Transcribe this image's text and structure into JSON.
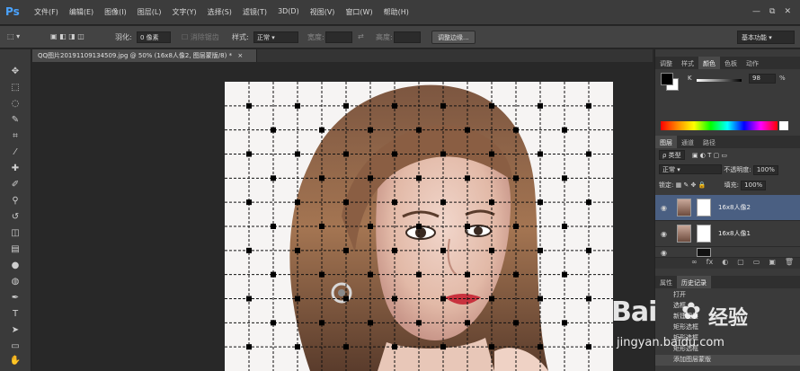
{
  "app": {
    "logo": "Ps"
  },
  "menu": [
    "文件(F)",
    "编辑(E)",
    "图像(I)",
    "图层(L)",
    "文字(Y)",
    "选择(S)",
    "滤镜(T)",
    "3D(D)",
    "视图(V)",
    "窗口(W)",
    "帮助(H)"
  ],
  "window_controls": [
    "—",
    "⧉",
    "✕"
  ],
  "options_bar": {
    "feather_label": "羽化:",
    "feather_value": "0 像素",
    "antialias_label": "消除锯齿",
    "style_label": "样式:",
    "style_value": "正常",
    "width_label": "宽度:",
    "height_label": "高度:",
    "refine_button": "调整边缘...",
    "workspace": "基本功能"
  },
  "document": {
    "tab_title": "QQ图片20191109134509.jpg @ 50% (16x8人像2, 图层蒙版/8) *",
    "close": "×"
  },
  "color_panel": {
    "tabs": [
      "调整",
      "样式",
      "颜色",
      "色板",
      "动作"
    ],
    "active_tab": 2,
    "channel": "K",
    "value": "98",
    "unit": "%"
  },
  "layers_panel": {
    "tabs": [
      "图层",
      "通道",
      "路径"
    ],
    "active_tab": 0,
    "kind_label": "ρ 类型",
    "blend_mode": "正常",
    "opacity_label": "不透明度:",
    "opacity_value": "100%",
    "lock_label": "锁定:",
    "fill_label": "填充:",
    "fill_value": "100%",
    "layers": [
      {
        "name": "16x8人像2",
        "selected": true,
        "mask": "white"
      },
      {
        "name": "16x8人像1",
        "selected": false,
        "mask": "white"
      },
      {
        "name": "",
        "selected": false,
        "mask": "dark"
      }
    ],
    "footer_icons": [
      "∞",
      "fx",
      "◐",
      "▢",
      "▭",
      "▣",
      "🗑"
    ]
  },
  "history_panel": {
    "tabs": [
      "属性",
      "历史记录"
    ],
    "active_tab": 1,
    "items": [
      "打开",
      "选框",
      "新建图层",
      "矩形选框",
      "矩形选框",
      "矩形选框",
      "添加图层蒙版"
    ]
  },
  "watermark": {
    "brand": "Bai",
    "brand_suffix": "经验",
    "url": "jingyan.baidu.com"
  },
  "colors": {
    "accent": "#4aa3ff",
    "selection": "#4a5f82"
  }
}
